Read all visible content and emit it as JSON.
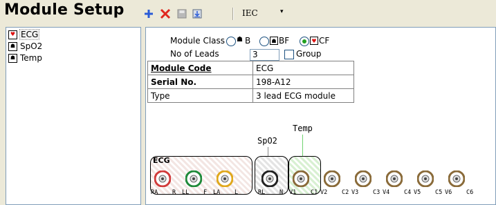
{
  "title": "Module Setup",
  "toolbar": {
    "standard": "IEC",
    "icons": [
      "add-icon",
      "delete-icon",
      "save-icon",
      "import-icon",
      "chevron-down-icon"
    ]
  },
  "modules": [
    {
      "name": "ECG",
      "icon": "heart-icon"
    },
    {
      "name": "SpO2",
      "icon": "person-icon"
    },
    {
      "name": "Temp",
      "icon": "person-icon"
    }
  ],
  "module_class": {
    "label": "Module Class",
    "options": [
      "B",
      "BF",
      "CF"
    ],
    "selected": "CF"
  },
  "leads": {
    "label": "No of Leads",
    "value": "3",
    "group_label": "Group",
    "group_checked": false
  },
  "table": [
    {
      "key": "Module Code",
      "value": "ECG"
    },
    {
      "key": "Serial No.",
      "value": "198-A12"
    },
    {
      "key": "Type",
      "value": "3 lead ECG module"
    }
  ],
  "diagram": {
    "temp_label": "Temp",
    "spo2_label": "SpO2",
    "ecg_label": "ECG",
    "pins": [
      "RA",
      "R",
      "LL",
      "F",
      "LA",
      "L",
      "RL",
      "N",
      "V1",
      "C1",
      "V2",
      "C2",
      "V3",
      "C3",
      "V4",
      "C4",
      "V5",
      "C5",
      "V6",
      "C6"
    ],
    "colors": {
      "ra": "#d13b3b",
      "ll": "#1f8a3a",
      "la": "#e0a81c",
      "rl": "#222222",
      "v": "#8a6b3a",
      "temp_line": "#6fd26f"
    }
  }
}
